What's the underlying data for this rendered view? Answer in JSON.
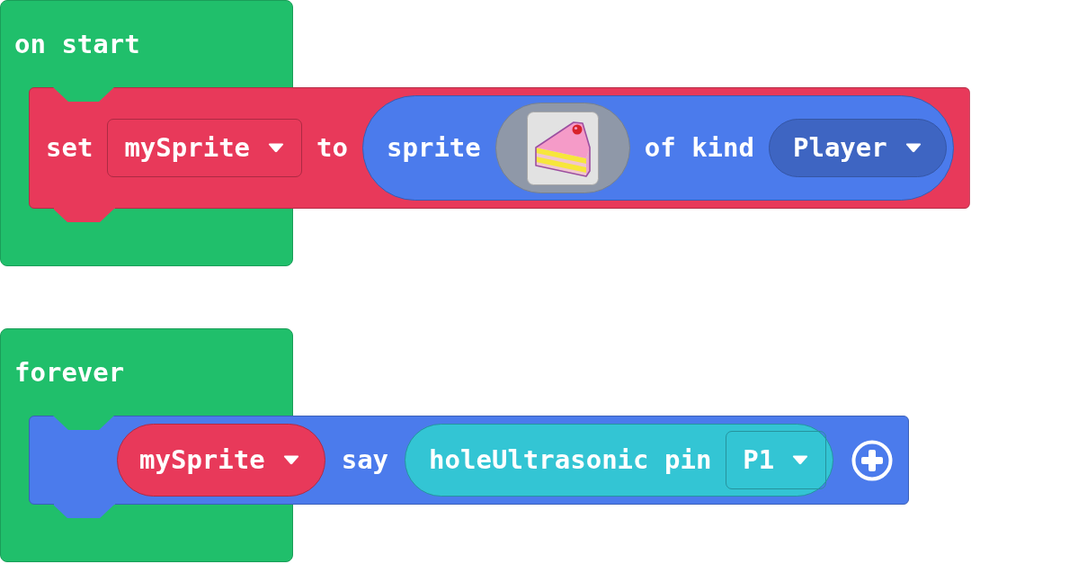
{
  "workspace": {
    "stacks": [
      {
        "hat": {
          "label": "on start",
          "color": "#20bf6b"
        },
        "statements": [
          {
            "kind": "assign",
            "color": "#e8395a",
            "parts": [
              {
                "kind": "label",
                "text": "set"
              },
              {
                "kind": "dropdown",
                "value": "mySprite"
              },
              {
                "kind": "label",
                "text": "to"
              },
              {
                "kind": "reporter",
                "color": "#4b7bec",
                "parts": [
                  {
                    "kind": "label",
                    "text": "sprite"
                  },
                  {
                    "kind": "image"
                  },
                  {
                    "kind": "label",
                    "text": "of kind"
                  },
                  {
                    "kind": "pill",
                    "value": "Player"
                  }
                ]
              }
            ]
          }
        ]
      },
      {
        "hat": {
          "label": "forever",
          "color": "#20bf6b"
        },
        "statements": [
          {
            "kind": "call",
            "color": "#4b7bec",
            "parts": [
              {
                "kind": "variable",
                "value": "mySprite",
                "color": "#e8395a"
              },
              {
                "kind": "label",
                "text": "say"
              },
              {
                "kind": "reporter",
                "color": "#33c5d4",
                "parts": [
                  {
                    "kind": "label",
                    "text": "holeUltrasonic pin"
                  },
                  {
                    "kind": "dropdown",
                    "value": "P1"
                  }
                ]
              },
              {
                "kind": "plus"
              }
            ]
          }
        ]
      }
    ]
  }
}
